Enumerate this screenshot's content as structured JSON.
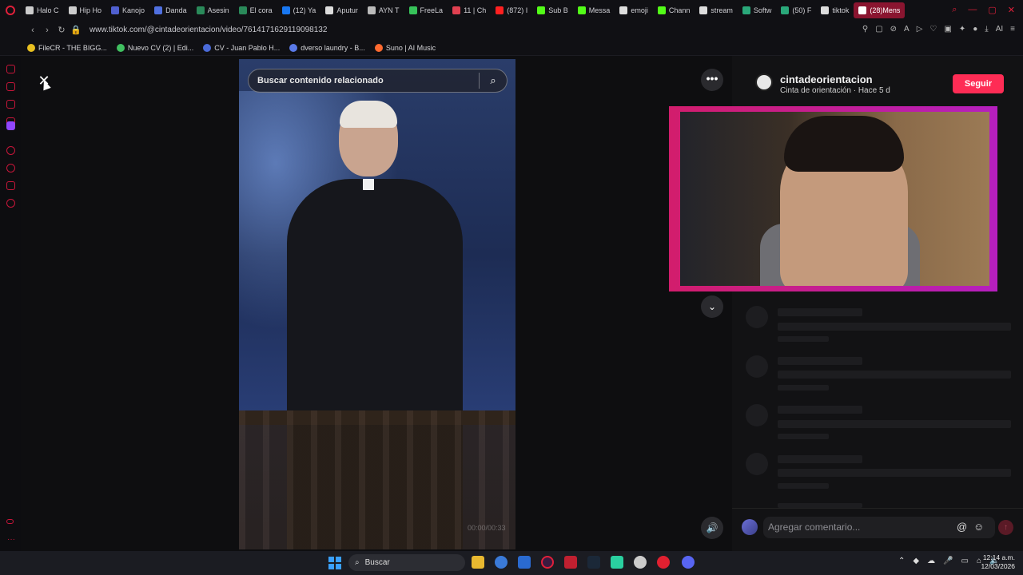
{
  "browser": {
    "tabs": [
      {
        "label": "Halo C",
        "color": "#cccccc"
      },
      {
        "label": "Hip Ho",
        "color": "#cccccc"
      },
      {
        "label": "Kanojo",
        "color": "#5060d0"
      },
      {
        "label": "Danda",
        "color": "#5070e0"
      },
      {
        "label": "Asesin",
        "color": "#2a8a5a"
      },
      {
        "label": "El cora",
        "color": "#2a8a5a"
      },
      {
        "label": "(12) Ya",
        "color": "#1877f2"
      },
      {
        "label": "Aputur",
        "color": "#dddddd"
      },
      {
        "label": "AYN T",
        "color": "#bbbbbb"
      },
      {
        "label": "FreeLa",
        "color": "#37c35a"
      },
      {
        "label": "11 | Ch",
        "color": "#e04050"
      },
      {
        "label": "(872) I",
        "color": "#ff2020"
      },
      {
        "label": "Sub B",
        "color": "#53fc18"
      },
      {
        "label": "Messa",
        "color": "#53fc18"
      },
      {
        "label": "emoji",
        "color": "#dddddd"
      },
      {
        "label": "Chann",
        "color": "#53fc18"
      },
      {
        "label": "stream",
        "color": "#dddddd"
      },
      {
        "label": "Softw",
        "color": "#2aa87a"
      },
      {
        "label": "(50) F",
        "color": "#2aa87a"
      },
      {
        "label": "tiktok",
        "color": "#dddddd"
      },
      {
        "label": "(28)Mens",
        "color": "#ffffff",
        "active": true
      }
    ],
    "url": "www.tiktok.com/@cintadeorientacion/video/7614171629119098132",
    "bookmarks": [
      {
        "label": "FileCR - THE BIGG...",
        "color": "#e8c020"
      },
      {
        "label": "Nuevo CV (2) | Edi...",
        "color": "#40c060"
      },
      {
        "label": "CV - Juan Pablo H...",
        "color": "#4a6ad8"
      },
      {
        "label": "dverso laundry - B...",
        "color": "#5a7ae8"
      },
      {
        "label": "Suno | AI Music",
        "color": "#ff6a30"
      }
    ]
  },
  "video": {
    "search_placeholder": "Buscar contenido relacionado",
    "timestamp": "00:00/00:33"
  },
  "author": {
    "name": "cintadeorientacion",
    "subtitle": "Cinta de orientación · Hace 5 d",
    "follow_label": "Seguir"
  },
  "comments": {
    "placeholder": "Agregar comentario..."
  },
  "taskbar": {
    "search_label": "Buscar",
    "time": "12:14 a.m.",
    "date": "12/03/2026"
  },
  "icons": {
    "close": "close-icon",
    "more": "more-icon",
    "chevron_down": "chevron-down-icon",
    "mute": "volume-icon",
    "search": "search-icon"
  },
  "colors": {
    "accent": "#fe2c55",
    "opera": "#e0203a",
    "webcam_frame": "#d21d6c"
  }
}
